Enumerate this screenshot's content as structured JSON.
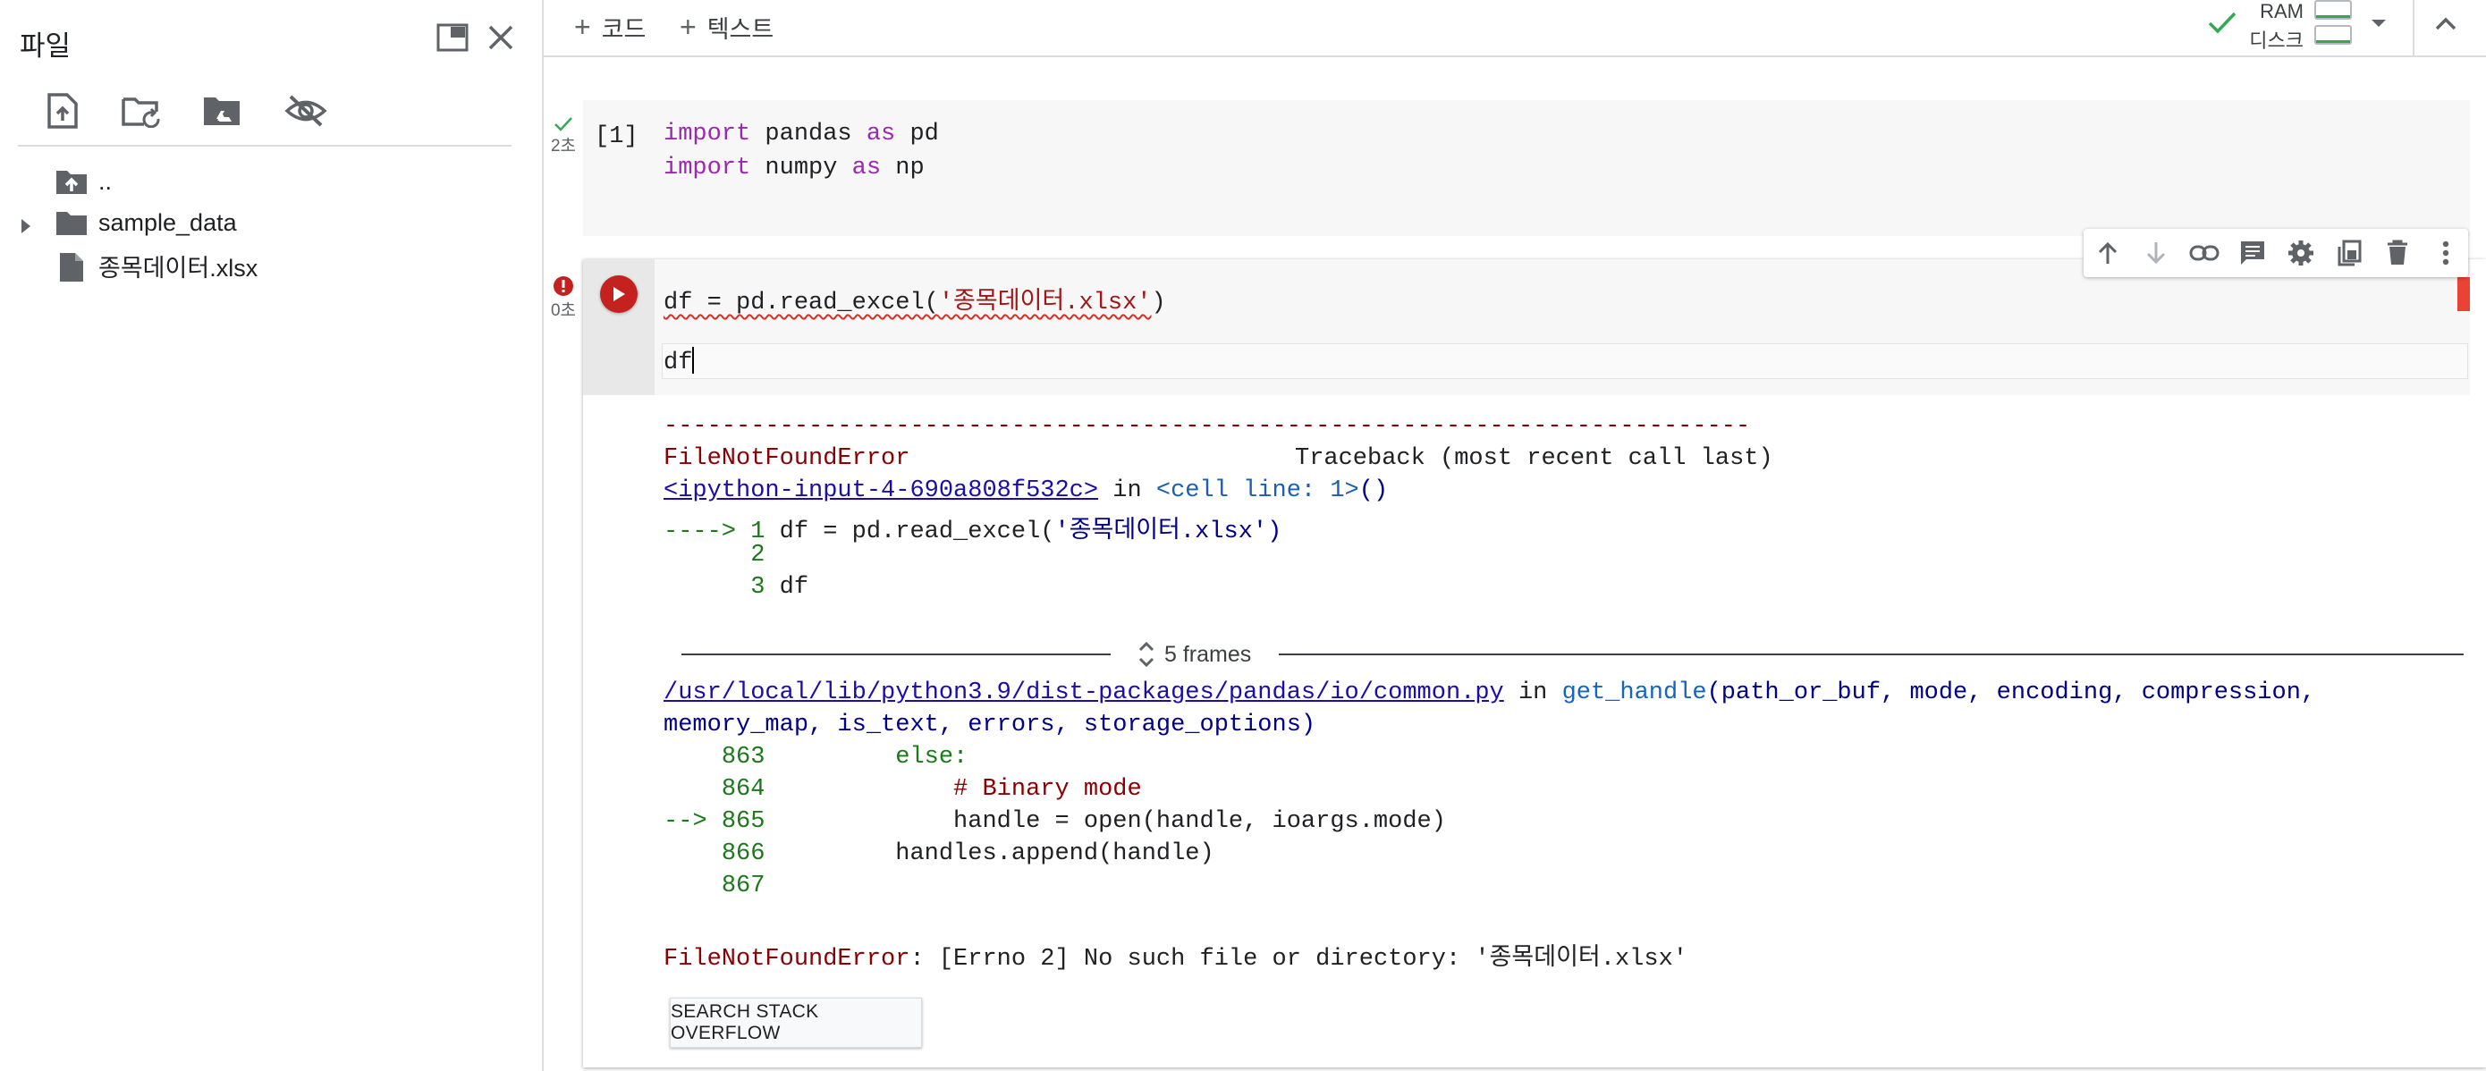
{
  "sidebar": {
    "title": "파일",
    "tree": [
      {
        "label": ".."
      },
      {
        "label": "sample_data"
      },
      {
        "label": "종목데이터.xlsx"
      }
    ]
  },
  "toolbar": {
    "add_code_label": "코드",
    "add_text_label": "텍스트",
    "ram_label": "RAM",
    "disk_label": "디스크"
  },
  "cells": [
    {
      "exec_count": "[1]",
      "exec_time": "2초",
      "status": "success",
      "lines": [
        {
          "kw1": "import",
          "mod": " pandas ",
          "kw2": "as",
          "alias": " pd"
        },
        {
          "kw1": "import",
          "mod": " numpy ",
          "kw2": "as",
          "alias": " np"
        }
      ]
    },
    {
      "exec_time": "0초",
      "status": "error",
      "line1_code": "df = pd.read_excel(",
      "line1_str": "'종목데이터.xlsx'",
      "line1_end": ")",
      "line2_code": "df"
    }
  ],
  "output": {
    "dashes": "---------------------------------------------------------------------------",
    "error_name": "FileNotFoundError",
    "traceback_label": "Traceback (most recent call last)",
    "frame1_link": "<ipython-input-4-690a808f532c>",
    "frame1_in": " in ",
    "frame1_loc": "<cell line: 1>",
    "frame1_paren": "()",
    "ctx1": [
      {
        "arrow": "----> ",
        "num": "1",
        "code": " df = pd.read_excel(",
        "str": "'종목데이터.xlsx'",
        "end": ")"
      },
      {
        "arrow": "      ",
        "num": "2",
        "code": "",
        "str": "",
        "end": ""
      },
      {
        "arrow": "      ",
        "num": "3",
        "code": " df",
        "str": "",
        "end": ""
      }
    ],
    "frames_label": "5 frames",
    "frame2_link": "/usr/local/lib/python3.9/dist-packages/pandas/io/common.py",
    "frame2_in": " in ",
    "frame2_func": "get_handle",
    "frame2_args1": "(path_or_buf, mode, encoding, compression,",
    "frame2_args2": "memory_map, is_text, errors, storage_options)",
    "ctx2": [
      {
        "arrow": "    ",
        "num": "863",
        "text": "         else:"
      },
      {
        "arrow": "    ",
        "num": "864",
        "text": "             # Binary mode"
      },
      {
        "arrow": "--> ",
        "num": "865",
        "text": "             handle = open(handle, ioargs.mode)"
      },
      {
        "arrow": "    ",
        "num": "866",
        "text": "         handles.append(handle)"
      },
      {
        "arrow": "    ",
        "num": "867",
        "text": ""
      }
    ],
    "final_error_name": "FileNotFoundError",
    "final_error_msg": ": [Errno 2] No such file or directory: '종목데이터.xlsx'",
    "search_button": "SEARCH STACK OVERFLOW"
  },
  "icons": {
    "sidebar": [
      "new-window-icon",
      "close-icon",
      "upload-icon",
      "refresh-folder-icon",
      "mount-drive-icon",
      "hide-files-icon"
    ],
    "cell_toolbar": [
      "move-up-icon",
      "move-down-icon",
      "link-icon",
      "comment-icon",
      "settings-icon",
      "mirror-cell-icon",
      "delete-icon",
      "more-icon"
    ]
  },
  "colors": {
    "run_error": "#c5221f",
    "success_check": "#34a853",
    "keyword": "#9c27b0",
    "string": "#a31515",
    "error_text": "#8b0000"
  }
}
